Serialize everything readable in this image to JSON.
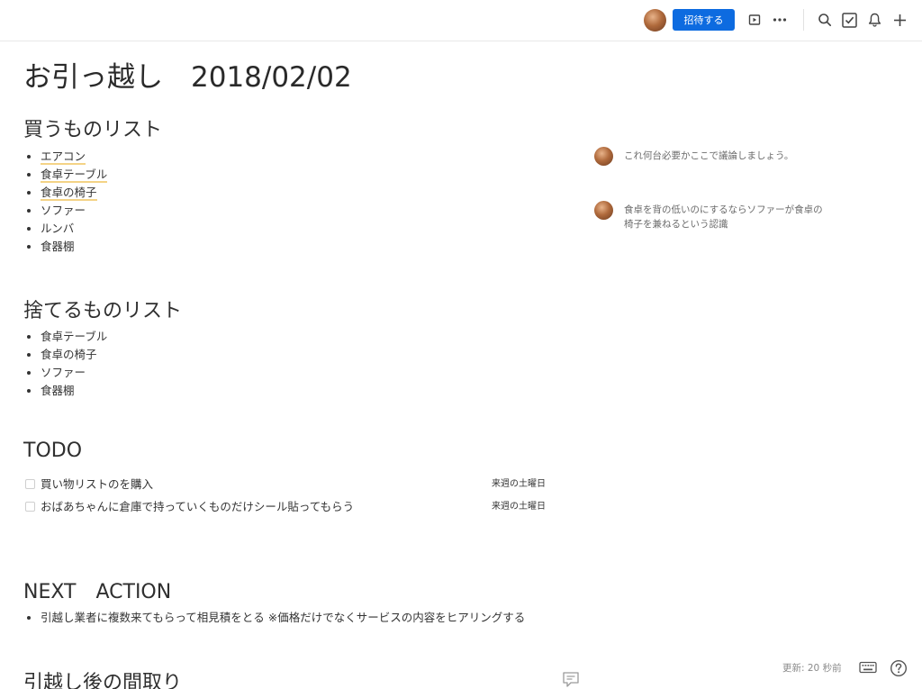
{
  "toolbar": {
    "invite_label": "招待する",
    "icons": [
      "avatar",
      "present-icon",
      "more-icon",
      "search-icon",
      "task-check-icon",
      "bell-icon",
      "plus-icon"
    ]
  },
  "page": {
    "title": "お引っ越し　2018/02/02"
  },
  "sections": {
    "buy": {
      "heading": "買うものリスト",
      "items": [
        "エアコン",
        "食卓テーブル",
        "食卓の椅子",
        "ソファー",
        "ルンバ",
        "食器棚"
      ]
    },
    "discard": {
      "heading": "捨てるものリスト",
      "items": [
        "食卓テーブル",
        "食卓の椅子",
        "ソファー",
        "食器棚"
      ]
    },
    "todo": {
      "heading": "TODO",
      "items": [
        {
          "text": "買い物リストのを購入",
          "date": "来週の土曜日",
          "checked": false
        },
        {
          "text": "おばあちゃんに倉庫で持っていくものだけシール貼ってもらう",
          "date": "来週の土曜日",
          "checked": false
        }
      ]
    },
    "next": {
      "heading": "NEXT　ACTION",
      "items": [
        "引越し業者に複数来てもらって相見積をとる ※価格だけでなくサービスの内容をヒアリングする"
      ]
    },
    "layout": {
      "heading": "引越し後の間取り"
    }
  },
  "comments": [
    {
      "text": "これ何台必要かここで議論しましょう。"
    },
    {
      "text": "食卓を背の低いのにするならソファーが食卓の椅子を兼ねるという認識"
    }
  ],
  "footer": {
    "updated": "更新: 20 秒前"
  },
  "colors": {
    "accent": "#0d6be0",
    "highlight": "#f4d386"
  }
}
